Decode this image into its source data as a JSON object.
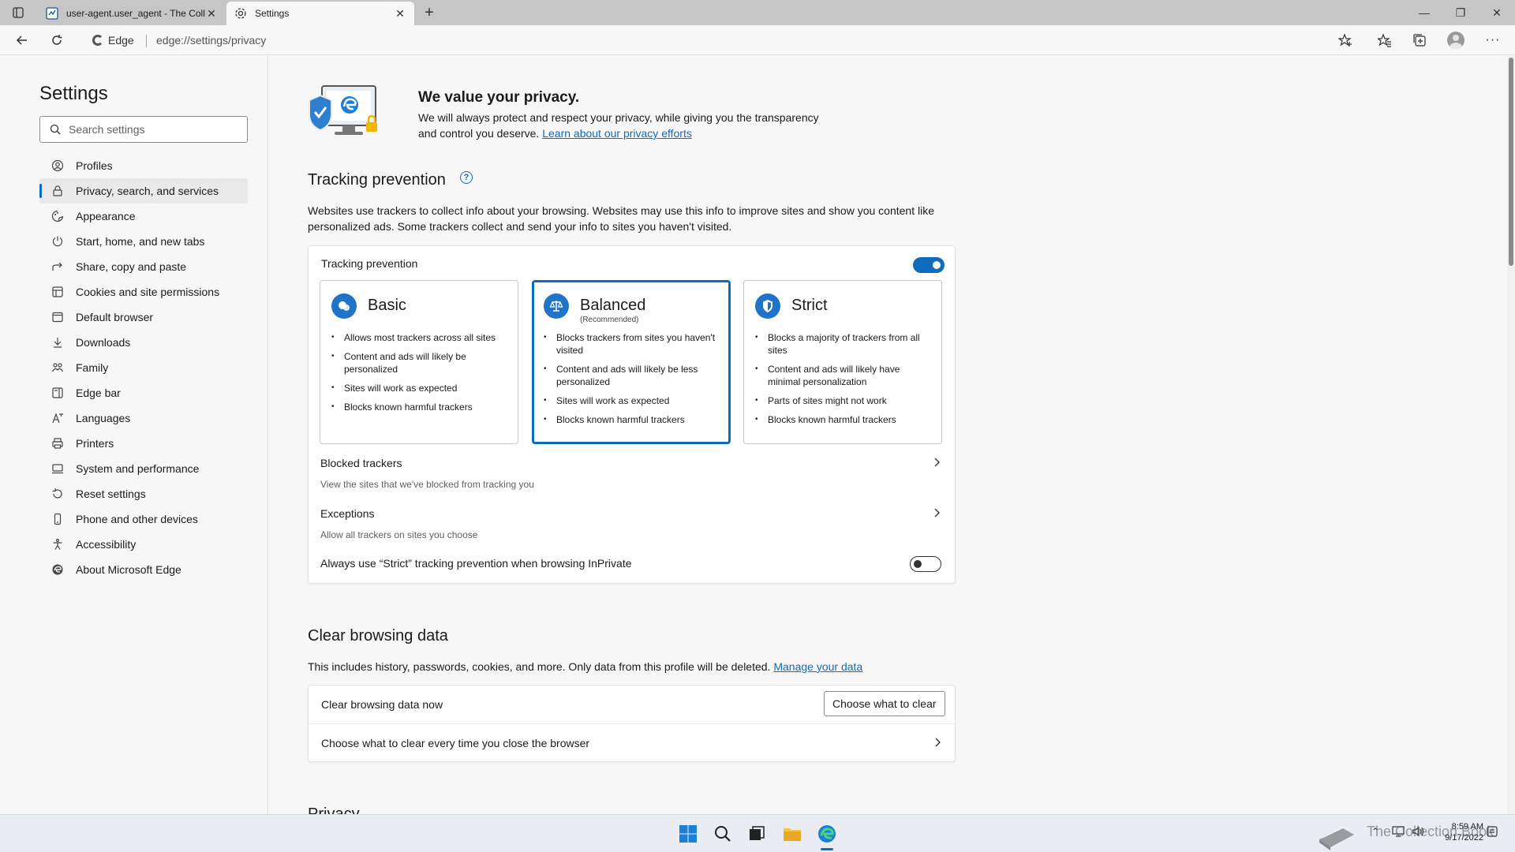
{
  "tabs": [
    {
      "title": "user-agent.user_agent - The Coll",
      "active": false
    },
    {
      "title": "Settings",
      "active": true
    }
  ],
  "address": {
    "site_label": "Edge",
    "url": "edge://settings/privacy"
  },
  "sidebar": {
    "title": "Settings",
    "search_placeholder": "Search settings",
    "items": [
      {
        "label": "Profiles",
        "icon": "profile-icon"
      },
      {
        "label": "Privacy, search, and services",
        "icon": "lock-icon",
        "selected": true
      },
      {
        "label": "Appearance",
        "icon": "appearance-icon"
      },
      {
        "label": "Start, home, and new tabs",
        "icon": "power-icon"
      },
      {
        "label": "Share, copy and paste",
        "icon": "share-icon"
      },
      {
        "label": "Cookies and site permissions",
        "icon": "cookies-icon"
      },
      {
        "label": "Default browser",
        "icon": "browser-icon"
      },
      {
        "label": "Downloads",
        "icon": "download-icon"
      },
      {
        "label": "Family",
        "icon": "family-icon"
      },
      {
        "label": "Edge bar",
        "icon": "edge-bar-icon"
      },
      {
        "label": "Languages",
        "icon": "languages-icon"
      },
      {
        "label": "Printers",
        "icon": "printer-icon"
      },
      {
        "label": "System and performance",
        "icon": "system-icon"
      },
      {
        "label": "Reset settings",
        "icon": "reset-icon"
      },
      {
        "label": "Phone and other devices",
        "icon": "phone-icon"
      },
      {
        "label": "Accessibility",
        "icon": "accessibility-icon"
      },
      {
        "label": "About Microsoft Edge",
        "icon": "edge-icon"
      }
    ]
  },
  "hero": {
    "title": "We value your privacy.",
    "desc": "We will always protect and respect your privacy, while giving you the transparency and control you deserve.",
    "link": "Learn about our privacy efforts"
  },
  "tracking": {
    "section_title": "Tracking prevention",
    "desc": "Websites use trackers to collect info about your browsing. Websites may use this info to improve sites and show you content like personalized ads. Some trackers collect and send your info to sites you haven't visited.",
    "toggle_label": "Tracking prevention",
    "toggle_on": true,
    "levels": [
      {
        "name": "Basic",
        "recommended": "",
        "bullets": [
          "Allows most trackers across all sites",
          "Content and ads will likely be personalized",
          "Sites will work as expected",
          "Blocks known harmful trackers"
        ]
      },
      {
        "name": "Balanced",
        "recommended": "(Recommended)",
        "bullets": [
          "Blocks trackers from sites you haven't visited",
          "Content and ads will likely be less personalized",
          "Sites will work as expected",
          "Blocks known harmful trackers"
        ]
      },
      {
        "name": "Strict",
        "recommended": "",
        "bullets": [
          "Blocks a majority of trackers from all sites",
          "Content and ads will likely have minimal personalization",
          "Parts of sites might not work",
          "Blocks known harmful trackers"
        ]
      }
    ],
    "selected_level": "Balanced",
    "blocked": {
      "label": "Blocked trackers",
      "sub": "View the sites that we've blocked from tracking you"
    },
    "exceptions": {
      "label": "Exceptions",
      "sub": "Allow all trackers on sites you choose"
    },
    "inprivate": {
      "label": "Always use “Strict” tracking prevention when browsing InPrivate",
      "on": false
    }
  },
  "clear": {
    "section_title": "Clear browsing data",
    "desc": "This includes history, passwords, cookies, and more. Only data from this profile will be deleted.",
    "link": "Manage your data",
    "now_label": "Clear browsing data now",
    "button": "Choose what to clear",
    "every_time": "Choose what to clear every time you close the browser"
  },
  "next_section_partial": "Privacy",
  "taskbar": {
    "time": "8:59 AM",
    "date": "9/17/2022"
  },
  "watermark": "The Collection Book",
  "colors": {
    "accent": "#0f6cbd",
    "taskbar": "#e9ecf2"
  }
}
